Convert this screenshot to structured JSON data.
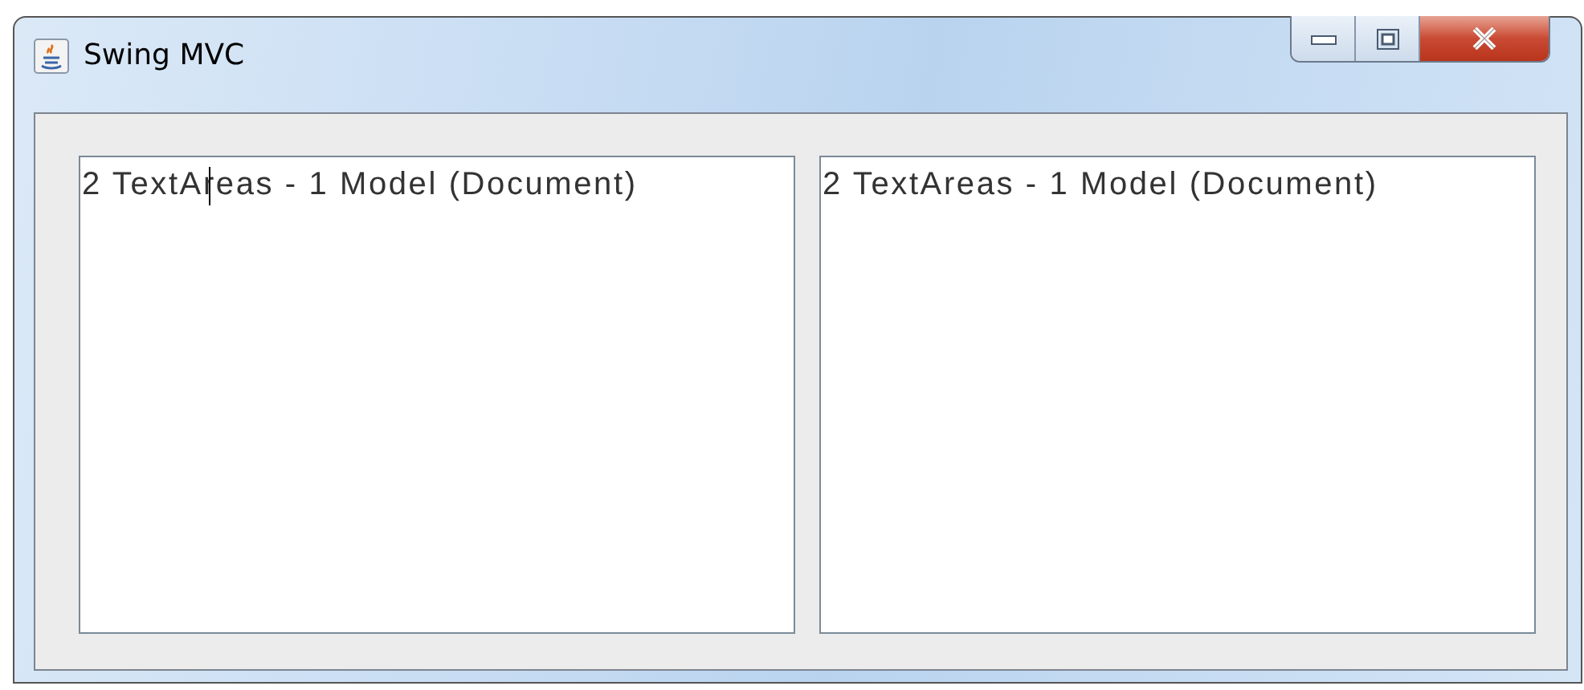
{
  "window": {
    "title": "Swing MVC",
    "controls": [
      {
        "kind": "minimize"
      },
      {
        "kind": "maximize"
      },
      {
        "kind": "close"
      }
    ]
  },
  "text_areas": [
    {
      "text": "2 TextAreas - 1 Model (Document)",
      "focused": true
    },
    {
      "text": "2 TextAreas - 1 Model (Document)",
      "focused": false
    }
  ]
}
